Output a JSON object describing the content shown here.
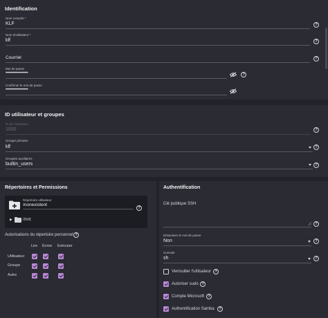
{
  "identification": {
    "title": "Identification",
    "full_name_label": "Nom complet *",
    "full_name_value": "KLF",
    "username_label": "Nom d'utilisateur *",
    "username_value": "klf",
    "email_placeholder": "Courriel",
    "password_label": "Mot de passe",
    "password_value": "••••••••••••••••••",
    "confirm_label": "Confirmer le mot de passe",
    "confirm_value": "••••••••••••••••••"
  },
  "ids": {
    "title": "ID utilisateur et groupes",
    "uid_label": "ID de l'utilisateur",
    "uid_value": "1000",
    "primary_group_label": "Groupe primaire",
    "primary_group_value": "klf",
    "aux_groups_label": "Groupes auxiliaires",
    "aux_groups_value": "builtin_users"
  },
  "directories": {
    "title": "Répertoires et Permissions",
    "home_label": "Répertoire utilisateur",
    "home_value": "/nonexistent",
    "tree_item": "/mnt",
    "perm_title": "Autorisations du répertoire personnel",
    "col_read": "Lire",
    "col_write": "Écrire",
    "col_exec": "Exécuter",
    "row_user": "Utilisateur",
    "row_group": "Groupe",
    "row_other": "Autre"
  },
  "auth": {
    "title": "Authentification",
    "ssh_label": "Clé publique SSH",
    "disable_pw_label": "Désactiver le mot de passe",
    "disable_pw_value": "Non",
    "shell_label": "Console",
    "shell_value": "sh",
    "lock_label": "Verrouiller l'utilisateur",
    "sudo_label": "Autoriser sudo",
    "microsoft_label": "Compte Microsoft",
    "samba_label": "Authentification Samba"
  },
  "colors": {
    "accent": "#b987d6",
    "card": "#2a2b33",
    "background": "#22232a"
  },
  "icons": [
    "help-icon",
    "eye-off-icon",
    "caret-down-icon",
    "folder-add-icon",
    "folder-icon",
    "chevron-right-icon"
  ]
}
